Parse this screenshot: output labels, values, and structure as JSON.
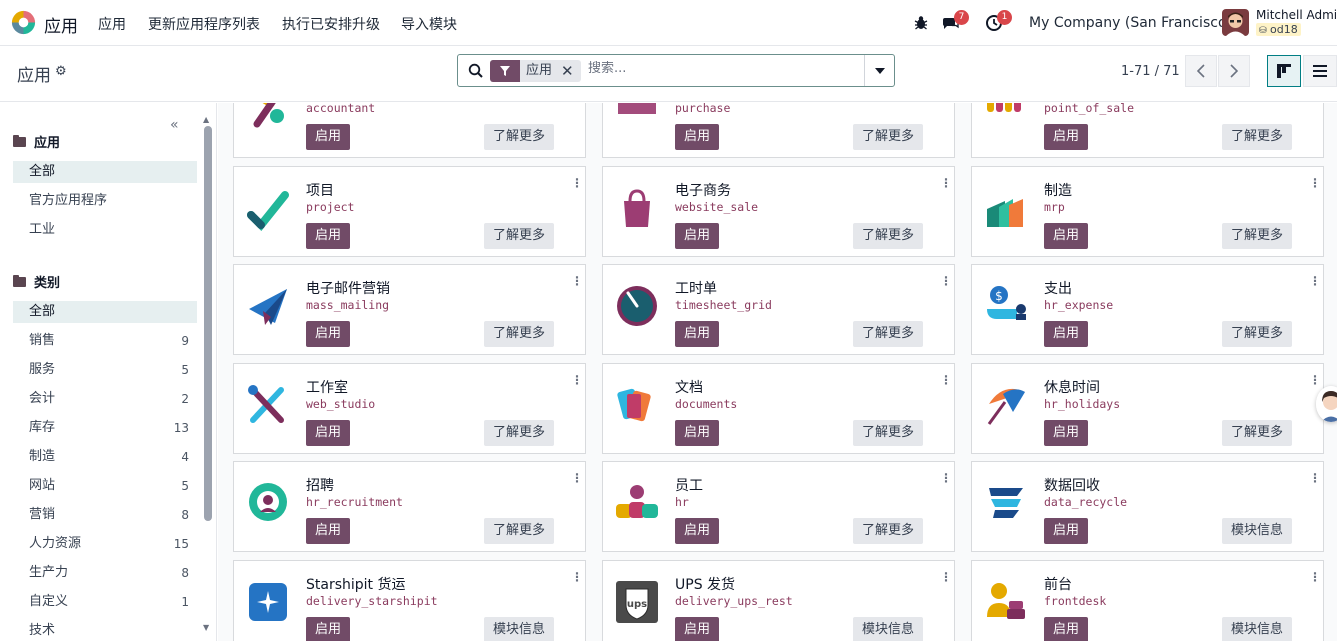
{
  "topbar": {
    "brand": "应用",
    "menu": [
      "应用",
      "更新应用程序列表",
      "执行已安排升级",
      "导入模块"
    ],
    "messages_badge": "7",
    "activity_badge": "1",
    "company": "My Company (San Francisco)",
    "user_name": "Mitchell Admin",
    "db_name": "od18",
    "icons": [
      "odoo-logo-icon",
      "bug-icon",
      "chat-icon",
      "clock-icon"
    ]
  },
  "control": {
    "breadcrumb": "应用",
    "facet_label": "应用",
    "search_placeholder": "搜索...",
    "pager": "1-71 / 71"
  },
  "sidebar": {
    "apps_header": "应用",
    "apps_items": [
      "全部",
      "官方应用程序",
      "工业"
    ],
    "categories_header": "类别",
    "category_items": [
      {
        "label": "全部",
        "count": ""
      },
      {
        "label": "销售",
        "count": "9"
      },
      {
        "label": "服务",
        "count": "5"
      },
      {
        "label": "会计",
        "count": "2"
      },
      {
        "label": "库存",
        "count": "13"
      },
      {
        "label": "制造",
        "count": "4"
      },
      {
        "label": "网站",
        "count": "5"
      },
      {
        "label": "营销",
        "count": "8"
      },
      {
        "label": "人力资源",
        "count": "15"
      },
      {
        "label": "生产力",
        "count": "8"
      },
      {
        "label": "自定义",
        "count": "1"
      },
      {
        "label": "技术",
        "count": ""
      }
    ]
  },
  "labels": {
    "activate": "启用",
    "learn_more": "了解更多",
    "module_info": "模块信息"
  },
  "cards": [
    {
      "title": "",
      "tech": "accountant",
      "btn2": "了解更多"
    },
    {
      "title": "",
      "tech": "purchase",
      "btn2": "了解更多"
    },
    {
      "title": "",
      "tech": "point_of_sale",
      "btn2": "了解更多"
    },
    {
      "title": "项目",
      "tech": "project",
      "btn2": "了解更多"
    },
    {
      "title": "电子商务",
      "tech": "website_sale",
      "btn2": "了解更多"
    },
    {
      "title": "制造",
      "tech": "mrp",
      "btn2": "了解更多"
    },
    {
      "title": "电子邮件营销",
      "tech": "mass_mailing",
      "btn2": "了解更多"
    },
    {
      "title": "工时单",
      "tech": "timesheet_grid",
      "btn2": "了解更多"
    },
    {
      "title": "支出",
      "tech": "hr_expense",
      "btn2": "了解更多"
    },
    {
      "title": "工作室",
      "tech": "web_studio",
      "btn2": "了解更多"
    },
    {
      "title": "文档",
      "tech": "documents",
      "btn2": "了解更多"
    },
    {
      "title": "休息时间",
      "tech": "hr_holidays",
      "btn2": "了解更多"
    },
    {
      "title": "招聘",
      "tech": "hr_recruitment",
      "btn2": "了解更多"
    },
    {
      "title": "员工",
      "tech": "hr",
      "btn2": "了解更多"
    },
    {
      "title": "数据回收",
      "tech": "data_recycle",
      "btn2": "模块信息"
    },
    {
      "title": "Starshipit 货运",
      "tech": "delivery_starshipit",
      "btn2": "模块信息"
    },
    {
      "title": "UPS 发货",
      "tech": "delivery_ups_rest",
      "btn2": "模块信息"
    },
    {
      "title": "前台",
      "tech": "frontdesk",
      "btn2": "模块信息"
    }
  ],
  "colors": {
    "primary": "#714b67",
    "accent": "#017e84",
    "tech_text": "#8a3b5e"
  }
}
